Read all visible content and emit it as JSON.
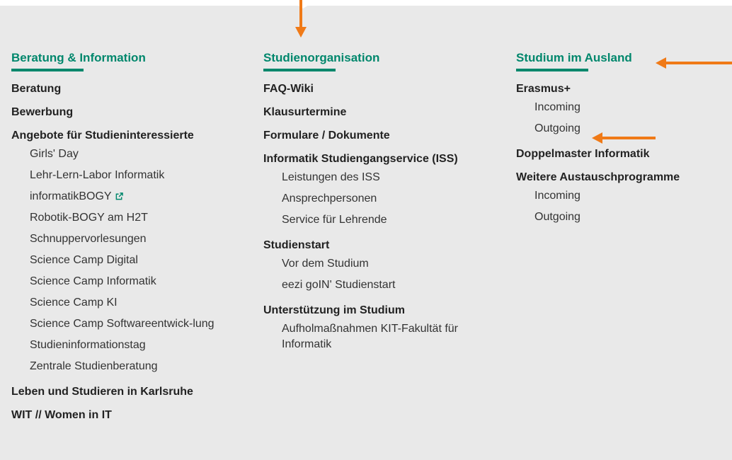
{
  "colors": {
    "accent": "#00876c",
    "arrow": "#f07a17",
    "background": "#e9e9e9"
  },
  "columns": [
    {
      "title": "Beratung & Information",
      "groups": [
        {
          "label": "Beratung"
        },
        {
          "label": "Bewerbung"
        },
        {
          "label": "Angebote für Studieninteressierte",
          "items": [
            "Girls' Day",
            "Lehr-Lern-Labor Informatik",
            "informatikBOGY",
            "Robotik-BOGY am H2T",
            "Schnuppervorlesungen",
            "Science Camp Digital",
            "Science Camp Informatik",
            "Science Camp KI",
            "Science Camp Softwareentwick-lung",
            "Studieninformationstag",
            "Zentrale Studienberatung"
          ]
        },
        {
          "label": "Leben und Studieren in Karlsruhe"
        },
        {
          "label": "WIT // Women in IT"
        }
      ]
    },
    {
      "title": "Studienorganisation",
      "groups": [
        {
          "label": "FAQ-Wiki"
        },
        {
          "label": "Klausurtermine"
        },
        {
          "label": "Formulare / Dokumente"
        },
        {
          "label": "Informatik Studiengangservice (ISS)",
          "items": [
            "Leistungen des ISS",
            "Ansprechpersonen",
            "Service für Lehrende"
          ]
        },
        {
          "label": "Studienstart",
          "items": [
            "Vor dem Studium",
            "eezi goIN' Studienstart"
          ]
        },
        {
          "label": "Unterstützung im Studium",
          "items": [
            "Aufholmaßnahmen KIT-Fakultät für Informatik"
          ]
        }
      ]
    },
    {
      "title": "Studium im Ausland",
      "groups": [
        {
          "label": "Erasmus+",
          "items": [
            "Incoming",
            "Outgoing"
          ]
        },
        {
          "label": "Doppelmaster Informatik"
        },
        {
          "label": "Weitere Austauschprogramme",
          "items": [
            "Incoming",
            "Outgoing"
          ]
        }
      ]
    }
  ],
  "external_link_icon": "external-link-icon",
  "arrow_icon": "arrow-icon"
}
